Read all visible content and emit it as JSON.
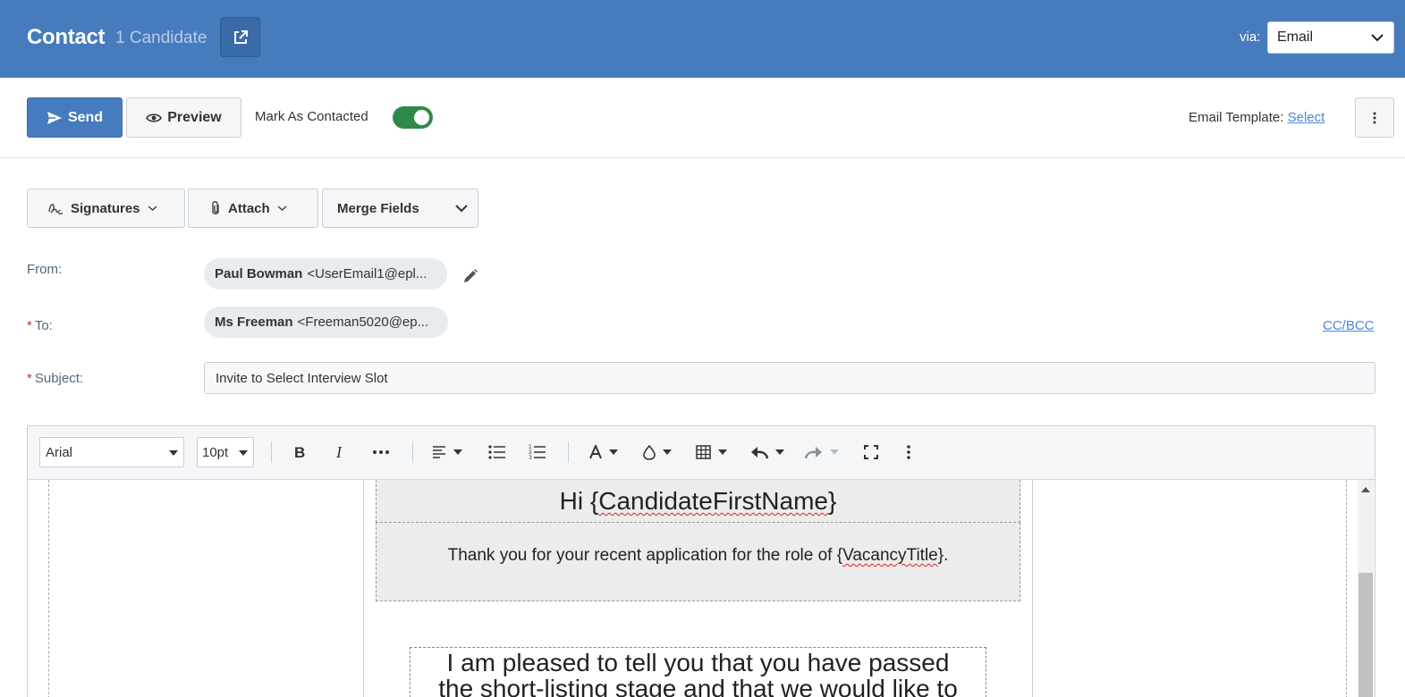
{
  "header": {
    "title": "Contact",
    "count": "1 Candidate",
    "via_label": "via:",
    "via_value": "Email"
  },
  "actions": {
    "send_label": "Send",
    "preview_label": "Preview",
    "mark_contacted_label": "Mark As Contacted",
    "mark_contacted_on": true,
    "template_label": "Email Template:",
    "template_link": "Select"
  },
  "tools": {
    "signatures": "Signatures",
    "attach": "Attach",
    "merge_fields": "Merge Fields"
  },
  "fields": {
    "from_label": "From:",
    "from_name": "Paul Bowman",
    "from_email": "<UserEmail1@epl...",
    "to_label": "To:",
    "to_name": "Ms Freeman",
    "to_email": "<Freeman5020@ep...",
    "ccbcc": "CC/BCC",
    "subject_label": "Subject:",
    "subject_value": "Invite to Select Interview Slot"
  },
  "editor": {
    "font": "Arial",
    "size": "10pt",
    "greeting_prefix": "Hi {",
    "greeting_field": "CandidateFirstName",
    "greeting_suffix": "}",
    "thanks_prefix": "Thank you for your recent application for the role of {",
    "thanks_field": "VacancyTitle",
    "thanks_suffix": "}.",
    "pleased_line1": "I am pleased to tell you that you have passed",
    "pleased_line2": "the short-listing stage and that we would like to"
  },
  "colors": {
    "header_bg": "#467bbd",
    "toggle_on": "#2f8a4a",
    "link": "#4a86d4",
    "required": "#c0392b"
  }
}
